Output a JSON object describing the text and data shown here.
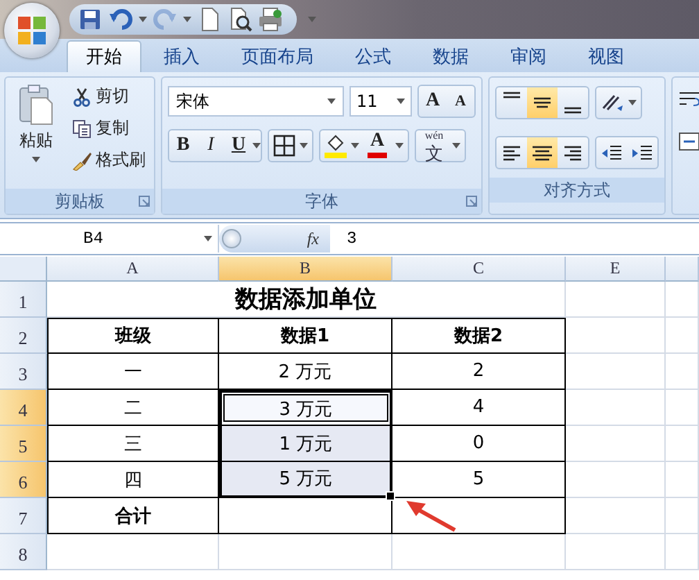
{
  "quick_access": [
    {
      "kind": "save",
      "disabled": false
    },
    {
      "kind": "undo",
      "disabled": false
    },
    {
      "kind": "redo",
      "disabled": true
    },
    {
      "kind": "new",
      "disabled": false
    },
    {
      "kind": "preview",
      "disabled": false
    },
    {
      "kind": "print",
      "disabled": false
    }
  ],
  "tabs": [
    {
      "label": "开始",
      "selected": true
    },
    {
      "label": "插入",
      "selected": false
    },
    {
      "label": "页面布局",
      "selected": false
    },
    {
      "label": "公式",
      "selected": false
    },
    {
      "label": "数据",
      "selected": false
    },
    {
      "label": "审阅",
      "selected": false
    },
    {
      "label": "视图",
      "selected": false
    }
  ],
  "clipboard": {
    "paste": "粘贴",
    "items": [
      {
        "kind": "cut",
        "label": "剪切"
      },
      {
        "kind": "copy",
        "label": "复制"
      },
      {
        "kind": "format_painter",
        "label": "格式刷"
      }
    ],
    "label": "剪贴板"
  },
  "font": {
    "name": "宋体",
    "size": "11",
    "grow": "A",
    "shrink": "A",
    "bold": "B",
    "italic": "I",
    "underline": "U",
    "font_color": "A",
    "phonetic_top": "wén",
    "phonetic_char": "文",
    "label": "字体"
  },
  "alignment": {
    "vertical": [
      {
        "kind": "top",
        "selected": false
      },
      {
        "kind": "middle",
        "selected": true
      },
      {
        "kind": "bottom",
        "selected": false
      }
    ],
    "horizontal": [
      {
        "kind": "left",
        "selected": false
      },
      {
        "kind": "center",
        "selected": true
      },
      {
        "kind": "right",
        "selected": false
      }
    ],
    "label": "对齐方式"
  },
  "formula_bar": {
    "name_box": "B4",
    "function_label": "fx",
    "formula": "3"
  },
  "columns": [
    {
      "label": "A",
      "selected": false
    },
    {
      "label": "B",
      "selected": true
    },
    {
      "label": "C",
      "selected": false
    },
    {
      "label": "E",
      "selected": false
    }
  ],
  "rows": [
    {
      "number": "1",
      "selected": false,
      "bordered": false,
      "cells": [
        {
          "text": "数据添加单位",
          "kind": "title",
          "colspan": 3,
          "selected": false,
          "active": false
        }
      ]
    },
    {
      "number": "2",
      "selected": false,
      "bordered": true,
      "cells": [
        {
          "text": "班级",
          "kind": "header",
          "selected": false,
          "active": false
        },
        {
          "text": "数据1",
          "kind": "header",
          "selected": false,
          "active": false
        },
        {
          "text": "数据2",
          "kind": "header",
          "selected": false,
          "active": false
        }
      ]
    },
    {
      "number": "3",
      "selected": false,
      "bordered": true,
      "cells": [
        {
          "text": "一",
          "kind": "plain",
          "selected": false,
          "active": false
        },
        {
          "text": "2 万元",
          "kind": "plain",
          "selected": false,
          "active": false
        },
        {
          "text": "2",
          "kind": "plain",
          "selected": false,
          "active": false
        }
      ]
    },
    {
      "number": "4",
      "selected": true,
      "bordered": true,
      "cells": [
        {
          "text": "二",
          "kind": "plain",
          "selected": false,
          "active": false
        },
        {
          "text": "3 万元",
          "kind": "plain",
          "selected": true,
          "active": true
        },
        {
          "text": "4",
          "kind": "plain",
          "selected": false,
          "active": false
        }
      ]
    },
    {
      "number": "5",
      "selected": true,
      "bordered": true,
      "cells": [
        {
          "text": "三",
          "kind": "plain",
          "selected": false,
          "active": false
        },
        {
          "text": "1 万元",
          "kind": "plain",
          "selected": true,
          "active": false
        },
        {
          "text": "0",
          "kind": "plain",
          "selected": false,
          "active": false
        }
      ]
    },
    {
      "number": "6",
      "selected": true,
      "bordered": true,
      "cells": [
        {
          "text": "四",
          "kind": "plain",
          "selected": false,
          "active": false
        },
        {
          "text": "5 万元",
          "kind": "plain",
          "selected": true,
          "active": false
        },
        {
          "text": "5",
          "kind": "plain",
          "selected": false,
          "active": false
        }
      ]
    },
    {
      "number": "7",
      "selected": false,
      "bordered": true,
      "cells": [
        {
          "text": "合计",
          "kind": "header",
          "selected": false,
          "active": false
        },
        {
          "kind": "plain",
          "selected": false,
          "active": false
        },
        {
          "kind": "plain",
          "selected": false,
          "active": false
        }
      ]
    },
    {
      "number": "8",
      "selected": false,
      "bordered": false,
      "cells": []
    }
  ]
}
